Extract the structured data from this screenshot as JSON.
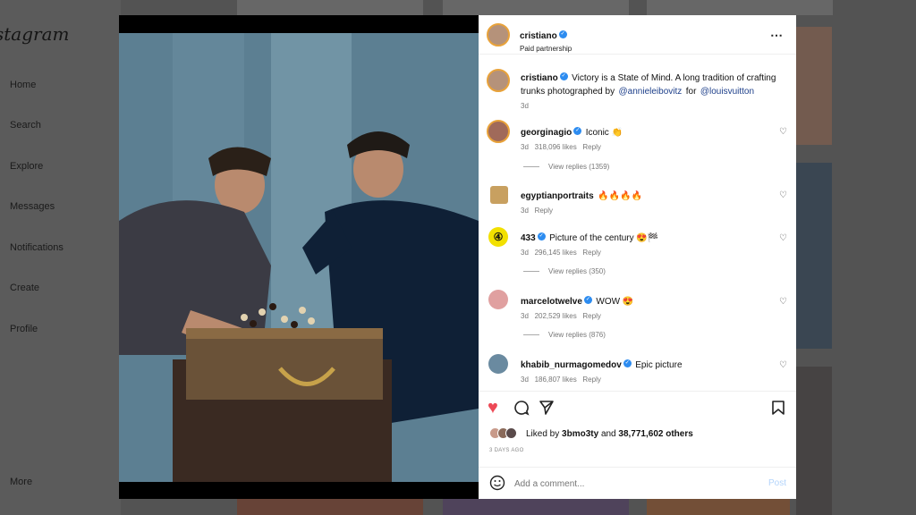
{
  "brand": "stagram",
  "nav": {
    "home": "Home",
    "search": "Search",
    "explore": "Explore",
    "messages": "Messages",
    "notifications": "Notifications",
    "create": "Create",
    "profile": "Profile",
    "more": "More"
  },
  "post": {
    "author": "cristiano",
    "partnership": "Paid partnership",
    "caption_author": "cristiano",
    "caption_text": "Victory is a State of Mind. A long tradition of crafting trunks photographed by",
    "caption_mention1": "@annieleibovitz",
    "caption_for": "for",
    "caption_mention2": "@louisvuitton",
    "caption_time": "3d",
    "likes_prefix": "Liked by",
    "likes_user": "3bmo3ty",
    "likes_and": "and",
    "likes_others": "38,771,602 others",
    "posted": "3 DAYS AGO",
    "comment_placeholder": "Add a comment...",
    "post_button": "Post"
  },
  "comments": [
    {
      "user": "georginagio",
      "text": "Iconic 👏",
      "time": "3d",
      "likes": "318,096 likes",
      "reply": "Reply",
      "views": "View replies (1359)"
    },
    {
      "user": "egyptianportraits",
      "text": "🔥🔥🔥🔥",
      "time": "3d",
      "likes": "",
      "reply": "Reply",
      "views": ""
    },
    {
      "user": "433",
      "text": "Picture of the century 😍🏁",
      "time": "3d",
      "likes": "296,145 likes",
      "reply": "Reply",
      "views": "View replies (350)"
    },
    {
      "user": "marcelotwelve",
      "text": "WOW 😍",
      "time": "3d",
      "likes": "202,529 likes",
      "reply": "Reply",
      "views": "View replies (876)"
    },
    {
      "user": "khabib_nurmagomedov",
      "text": "Epic picture",
      "time": "3d",
      "likes": "186,807 likes",
      "reply": "Reply",
      "views": ""
    }
  ],
  "colors": {
    "liked_heart": "#ed4956",
    "link": "#1d3f8a",
    "verified": "#2d8cf0"
  }
}
